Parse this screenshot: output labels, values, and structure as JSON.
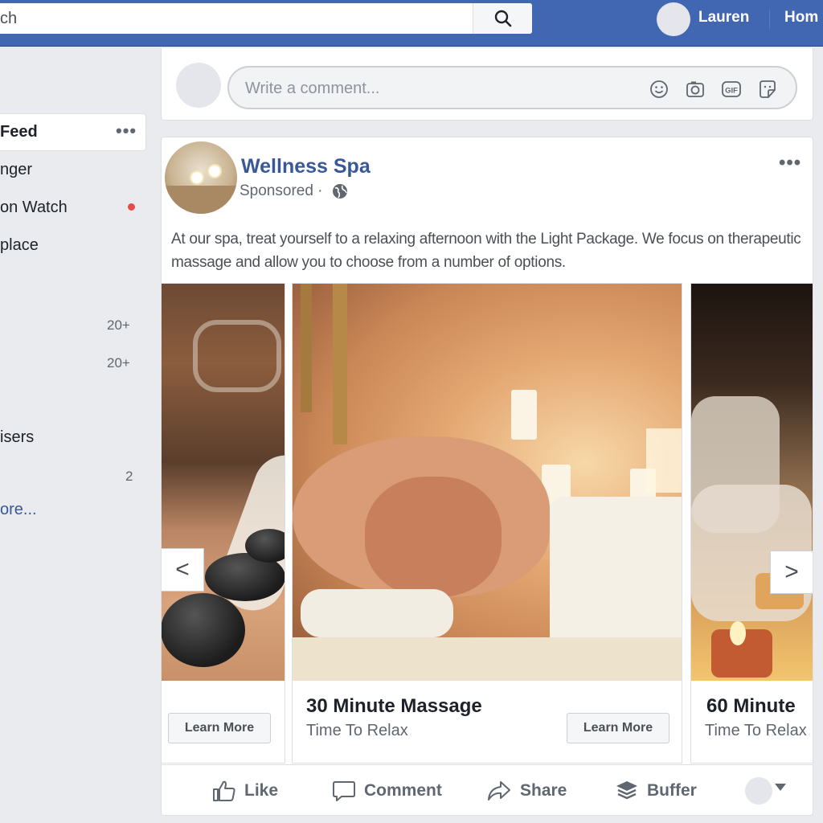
{
  "header": {
    "search_text": "ch",
    "user_name": "Lauren",
    "home_label": "Hom"
  },
  "sidebar": {
    "items": [
      {
        "label": "Feed"
      },
      {
        "label": "nger"
      },
      {
        "label": "on Watch"
      },
      {
        "label": "place"
      },
      {
        "label": "isers"
      }
    ],
    "counts": [
      "20+",
      "20+",
      "2"
    ],
    "see_more": "ore..."
  },
  "comment": {
    "placeholder": "Write a comment..."
  },
  "post": {
    "page_name": "Wellness Spa",
    "sponsored": "Sponsored ·",
    "text": "At our spa, treat yourself to a relaxing afternoon with the Light Package. We focus on therapeutic massage and allow you to choose from a number of options.",
    "carousel": [
      {
        "title": "",
        "subtitle": "",
        "button": "Learn More"
      },
      {
        "title": "30 Minute Massage",
        "subtitle": "Time To Relax",
        "button": "Learn More"
      },
      {
        "title": "60 Minute",
        "subtitle": "Time To Relax",
        "button": ""
      }
    ],
    "prev_arrow": "<",
    "next_arrow": ">",
    "actions": {
      "like": "Like",
      "comment": "Comment",
      "share": "Share",
      "buffer": "Buffer"
    }
  },
  "colors": {
    "brand": "#4267b2",
    "link": "#385898",
    "notification_dot": "#e64b4b"
  },
  "icons": [
    "search-icon",
    "smiley-icon",
    "camera-icon",
    "gif-icon",
    "sticker-icon",
    "globe-icon",
    "like-icon",
    "comment-icon",
    "share-icon",
    "buffer-icon"
  ]
}
